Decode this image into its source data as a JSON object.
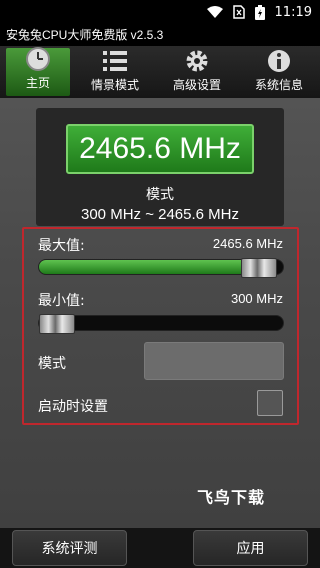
{
  "status_bar": {
    "time": "11:19"
  },
  "app": {
    "title": "安兔兔CPU大师免费版 v2.5.3"
  },
  "tabs": [
    {
      "label": "主页",
      "icon": "clock-icon",
      "active": true
    },
    {
      "label": "情景模式",
      "icon": "list-icon",
      "active": false
    },
    {
      "label": "高级设置",
      "icon": "gear-icon",
      "active": false
    },
    {
      "label": "系统信息",
      "icon": "info-icon",
      "active": false
    }
  ],
  "frequency": {
    "current": "2465.6 MHz",
    "mode_label": "模式",
    "range": "300 MHz ~ 2465.6 MHz"
  },
  "settings": {
    "max_label": "最大值:",
    "max_value": "2465.6 MHz",
    "max_slider_fraction": 0.97,
    "min_label": "最小值:",
    "min_value": "300 MHz",
    "min_slider_fraction": 0.0,
    "mode_label": "模式",
    "mode_value": "",
    "boot_label": "启动时设置",
    "boot_checked": false
  },
  "watermark": "飞鸟下载",
  "bottom": {
    "benchmark_label": "系统评测",
    "apply_label": "应用"
  },
  "colors": {
    "accent_green": "#2f8f28",
    "highlight_red": "#c0272d"
  }
}
